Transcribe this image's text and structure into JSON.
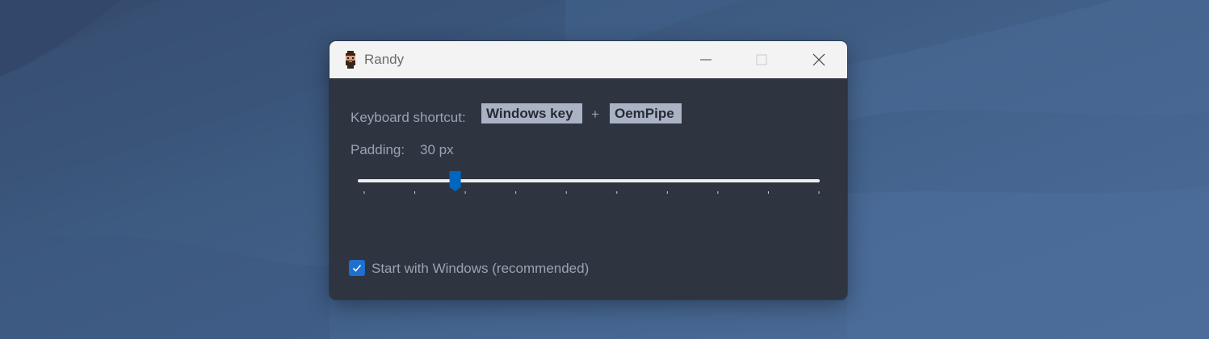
{
  "window": {
    "title": "Randy",
    "controls": {
      "minimize": "minimize-icon",
      "maximize": "maximize-icon",
      "close": "close-icon"
    }
  },
  "shortcut": {
    "label": "Keyboard shortcut:",
    "modifier": "Windows key",
    "plus": "+",
    "key": "OemPipe"
  },
  "padding": {
    "label": "Padding:",
    "value_text": "30 px",
    "slider_position": 0.2,
    "tick_count": 10
  },
  "startup": {
    "label": "Start with Windows (recommended)",
    "checked": true
  },
  "colors": {
    "accent": "#0067c0",
    "window_bg": "#2f3441",
    "titlebar_bg": "#f3f3f3",
    "key_bg": "#a9b3c4",
    "label_text": "#9aa3b2"
  }
}
